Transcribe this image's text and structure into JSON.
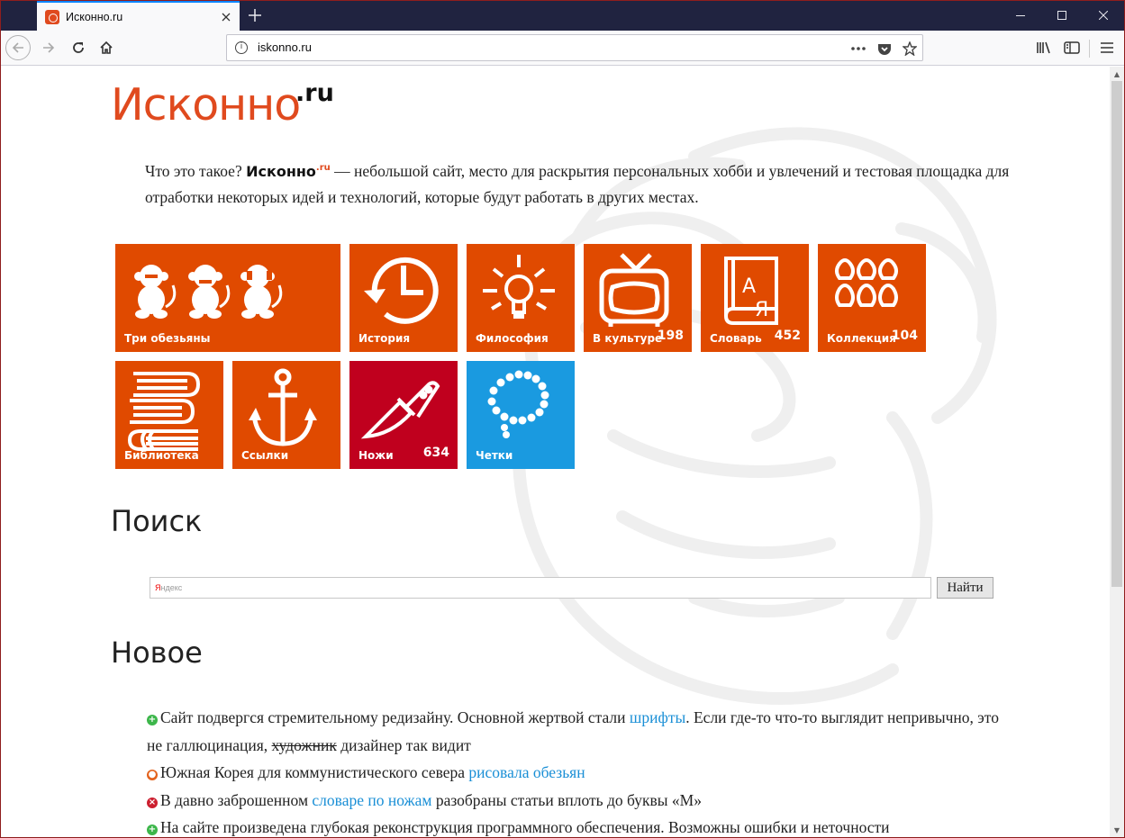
{
  "browser": {
    "tab_title": "Исконно.ru",
    "url": "iskonno.ru",
    "colors": {
      "tabbar": "#202340",
      "accent": "#0a84ff"
    }
  },
  "site": {
    "logo_main": "Исконно",
    "logo_sup": ".ru",
    "intro": {
      "lead": "Что это такое?",
      "brand": "Исконно",
      "brand_sup": ".ru",
      "rest": "— небольшой сайт, место для раскрытия персональных хобби и увлечений и тестовая площадка для отработки некоторых идей и технологий, которые будут работать в других местах."
    },
    "tiles": [
      {
        "label": "Три обезьяны",
        "count": "",
        "icon": "three-monkeys-icon"
      },
      {
        "label": "История",
        "count": "",
        "icon": "clock-history-icon"
      },
      {
        "label": "Философия",
        "count": "",
        "icon": "lightbulb-icon"
      },
      {
        "label": "В культуре",
        "count": "198",
        "icon": "tv-icon"
      },
      {
        "label": "Словарь",
        "count": "452",
        "icon": "dictionary-book-icon"
      },
      {
        "label": "Коллекция",
        "count": "104",
        "icon": "collection-grid-icon"
      },
      {
        "label": "Библиотека",
        "count": "",
        "icon": "books-stack-icon"
      },
      {
        "label": "Ссылки",
        "count": "",
        "icon": "anchor-icon"
      },
      {
        "label": "Ножи",
        "count": "634",
        "icon": "knife-icon"
      },
      {
        "label": "Четки",
        "count": "",
        "icon": "prayer-beads-icon"
      }
    ],
    "colors": {
      "tile_orange": "#e04a00",
      "tile_red": "#c0001e",
      "tile_blue": "#1a9ae0",
      "link": "#1a8fd6"
    },
    "search": {
      "heading": "Поиск",
      "placeholder_brand": "Я",
      "placeholder_rest": "ндекс",
      "button": "Найти"
    },
    "news": {
      "heading": "Новое",
      "items": [
        {
          "status": "green",
          "t1": "Сайт подвергся стремительному редизайну. Основной жертвой стали ",
          "link": "шрифты",
          "t2": ". Если где-то что-то выглядит непривычно, это не галлюцинация, ",
          "strike": "художник",
          "t3": " дизайнер так видит"
        },
        {
          "status": "orange",
          "t1": "Южная Корея для коммунистического севера ",
          "link": "рисовала обезьян",
          "t2": ""
        },
        {
          "status": "red",
          "t1": "В давно заброшенном ",
          "link": "словаре по ножам",
          "t2": " разобраны статьи вплоть до буквы «М»"
        },
        {
          "status": "green",
          "t1": "На сайте произведена глубокая реконструкция программного обеспечения. Возможны ошибки и неточности",
          "link": "",
          "t2": ""
        }
      ]
    }
  }
}
